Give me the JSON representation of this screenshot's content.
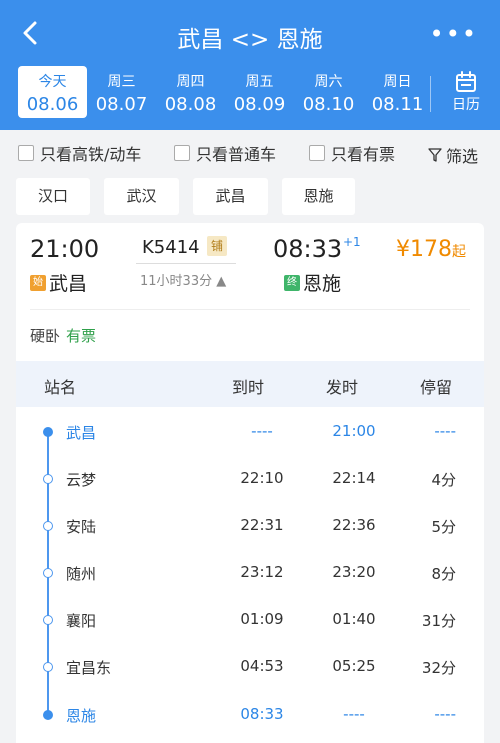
{
  "nav": {
    "title": "武昌 <> 恩施",
    "more": "•••"
  },
  "dates": [
    {
      "weekday": "今天",
      "date": "08.06"
    },
    {
      "weekday": "周三",
      "date": "08.07"
    },
    {
      "weekday": "周四",
      "date": "08.08"
    },
    {
      "weekday": "周五",
      "date": "08.09"
    },
    {
      "weekday": "周六",
      "date": "08.10"
    },
    {
      "weekday": "周日",
      "date": "08.11"
    }
  ],
  "calendar_label": "日历",
  "filters": {
    "high_speed": "只看高铁/动车",
    "normal": "只看普通车",
    "available": "只看有票",
    "filter": "筛选"
  },
  "station_tags": [
    "汉口",
    "武汉",
    "武昌",
    "恩施"
  ],
  "train": {
    "dep_time": "21:00",
    "arr_time": "08:33",
    "day_offset": "+1",
    "number": "K5414",
    "badge": "铺",
    "duration": "11小时33分 ▲",
    "price_amount": "¥178",
    "price_suffix": "起",
    "from_badge": "始",
    "from": "武昌",
    "to_badge": "终",
    "to": "恩施",
    "seat_type": "硬卧",
    "seat_status": "有票"
  },
  "table": {
    "headers": {
      "name": "站名",
      "arrive": "到时",
      "depart": "发时",
      "stay": "停留"
    },
    "rows": [
      {
        "name": "武昌",
        "arrive": "----",
        "depart": "21:00",
        "stay": "----"
      },
      {
        "name": "云梦",
        "arrive": "22:10",
        "depart": "22:14",
        "stay": "4分"
      },
      {
        "name": "安陆",
        "arrive": "22:31",
        "depart": "22:36",
        "stay": "5分"
      },
      {
        "name": "随州",
        "arrive": "23:12",
        "depart": "23:20",
        "stay": "8分"
      },
      {
        "name": "襄阳",
        "arrive": "01:09",
        "depart": "01:40",
        "stay": "31分"
      },
      {
        "name": "宜昌东",
        "arrive": "04:53",
        "depart": "05:25",
        "stay": "32分"
      },
      {
        "name": "恩施",
        "arrive": "08:33",
        "depart": "----",
        "stay": "----"
      }
    ]
  },
  "colors": {
    "brand": "#3b8fec",
    "price": "#f08a00",
    "ok": "#2fa04a",
    "start_badge": "#f0a030",
    "end_badge": "#3fb56a"
  }
}
